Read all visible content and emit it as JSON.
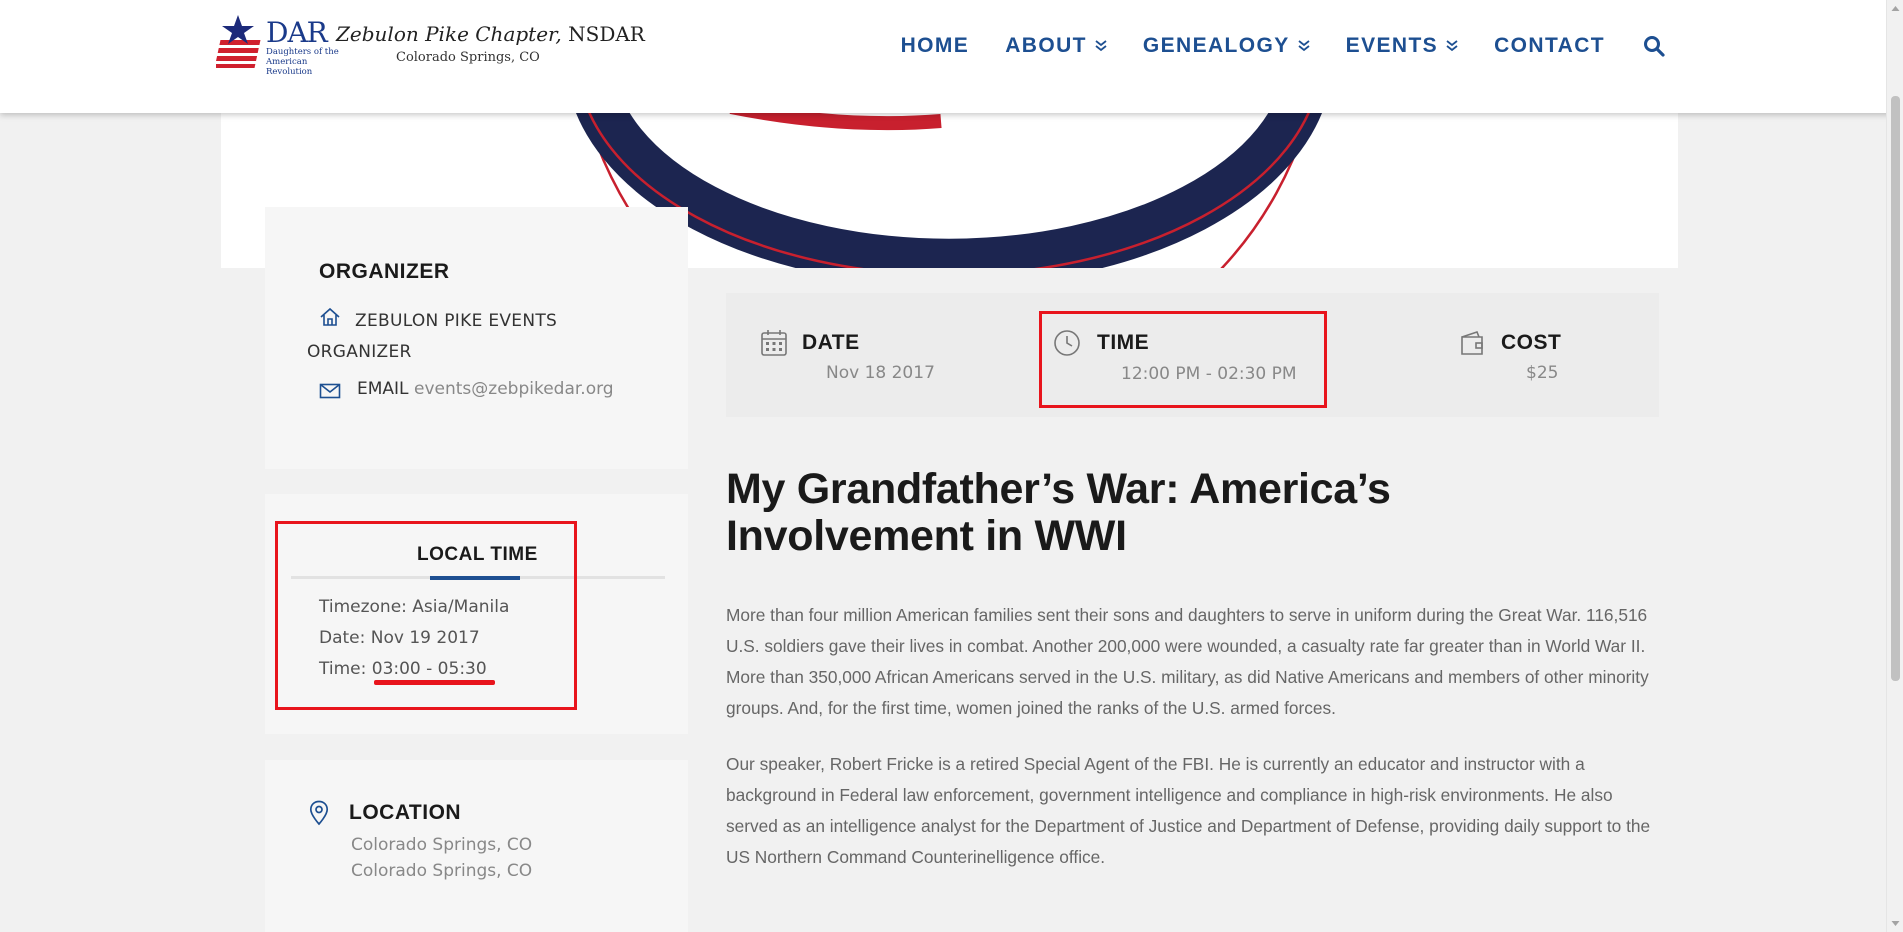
{
  "header": {
    "logo": {
      "dar": "DAR",
      "sub_line_1": "Daughters of the",
      "sub_line_2": "American Revolution",
      "chapter_italic": "Zebulon Pike Chapter,",
      "chapter_org": " NSDAR",
      "city": "Colorado Springs, CO"
    },
    "nav": [
      {
        "label": "HOME",
        "has_dropdown": false
      },
      {
        "label": "ABOUT",
        "has_dropdown": true
      },
      {
        "label": "GENEALOGY",
        "has_dropdown": true
      },
      {
        "label": "EVENTS",
        "has_dropdown": true
      },
      {
        "label": "CONTACT",
        "has_dropdown": false
      }
    ],
    "search_icon": "search-icon"
  },
  "organizer": {
    "title": "ORGANIZER",
    "name": "ZEBULON PIKE EVENTS ORGANIZER",
    "email_label": "EMAIL",
    "email": "events@zebpikedar.org"
  },
  "local_time": {
    "title": "LOCAL TIME",
    "timezone": "Timezone: Asia/Manila",
    "date": "Date: Nov 19 2017",
    "time_label": "Time: ",
    "time_value": "03:00 - 05:30"
  },
  "location": {
    "title": "LOCATION",
    "line1": "Colorado Springs, CO",
    "line2": "Colorado Springs, CO"
  },
  "info": {
    "date_label": "DATE",
    "date_value": "Nov 18 2017",
    "time_label": "TIME",
    "time_value": "12:00 PM - 02:30 PM",
    "cost_label": "COST",
    "cost_value": "$25"
  },
  "event": {
    "title": "My Grandfather’s War: America’s Involvement in WWI",
    "paragraph_1": "More than four million American families sent their sons and daughters to serve in uniform during the Great War. 116,516 U.S. soldiers gave their lives in combat. Another 200,000 were wounded, a casualty rate far greater than in World War II. More than 350,000 African Americans served in the U.S. military, as did Native Americans and members of other minority groups. And, for the first time, women joined the ranks of the U.S. armed forces.",
    "paragraph_2": "Our speaker, Robert Fricke is a retired Special Agent of the FBI. He is currently an educator and instructor with a background in Federal law enforcement, government intelligence and compliance in high-risk environments. He also served as an intelligence analyst for the Department of Justice and Department of Defense, providing daily support to the US Northern Command Counterinelligence office."
  },
  "colors": {
    "brand_blue": "#1d4f91",
    "highlight_red": "#e8141c",
    "navy": "#1c2550",
    "flag_red": "#c8202e"
  }
}
